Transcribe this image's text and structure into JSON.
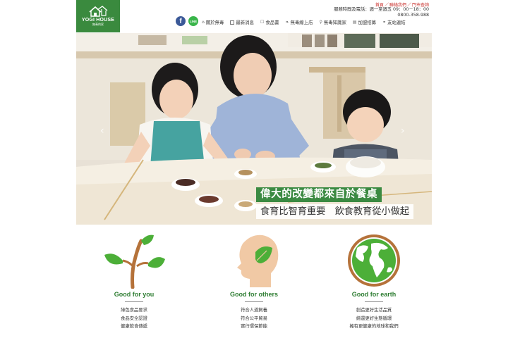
{
  "logo": {
    "brand_en": "YOGI HOUSE",
    "brand_zh": "無毒的家"
  },
  "top_links": [
    "首頁",
    "聯絡我們",
    "門市查詢"
  ],
  "top_links_separator": "／",
  "service": {
    "hours_label": "服務時間及電話：週一至週五 09：00－18：00",
    "phone": "0800-358-988"
  },
  "social": {
    "facebook": "f",
    "line": "LINE"
  },
  "nav": [
    {
      "label": "關於無毒",
      "icon": "house-icon"
    },
    {
      "label": "最新消息",
      "icon": "news-icon"
    },
    {
      "label": "食品書",
      "icon": "book-icon"
    },
    {
      "label": "無毒線上店",
      "icon": "leaf-icon"
    },
    {
      "label": "無毒知識家",
      "icon": "shop-icon"
    },
    {
      "label": "加盟招募",
      "icon": "store-icon"
    },
    {
      "label": "友站連結",
      "icon": "link-icon"
    }
  ],
  "hero": {
    "headline": "偉大的改變都來自於餐桌",
    "subline": "食育比智育重要　飲食教育從小做起",
    "prev": "‹",
    "next": "›"
  },
  "columns": [
    {
      "title": "Good for you",
      "lines": [
        "綠色食品要求",
        "食品安全認證",
        "健康飲食傳遞"
      ],
      "icon": "sprout-icon"
    },
    {
      "title": "Good for others",
      "lines": [
        "符合人道飼養",
        "符合公平貿易",
        "實行環保節能"
      ],
      "icon": "head-leaf-icon"
    },
    {
      "title": "Good for earth",
      "lines": [
        "創造更好生活品質",
        "締還更好生態循環",
        "擁有更健康的地球和我們"
      ],
      "icon": "globe-icon"
    }
  ],
  "colors": {
    "brand_green": "#3a8a3e",
    "accent_red": "#c9302c",
    "title_green": "#2e7d32"
  }
}
